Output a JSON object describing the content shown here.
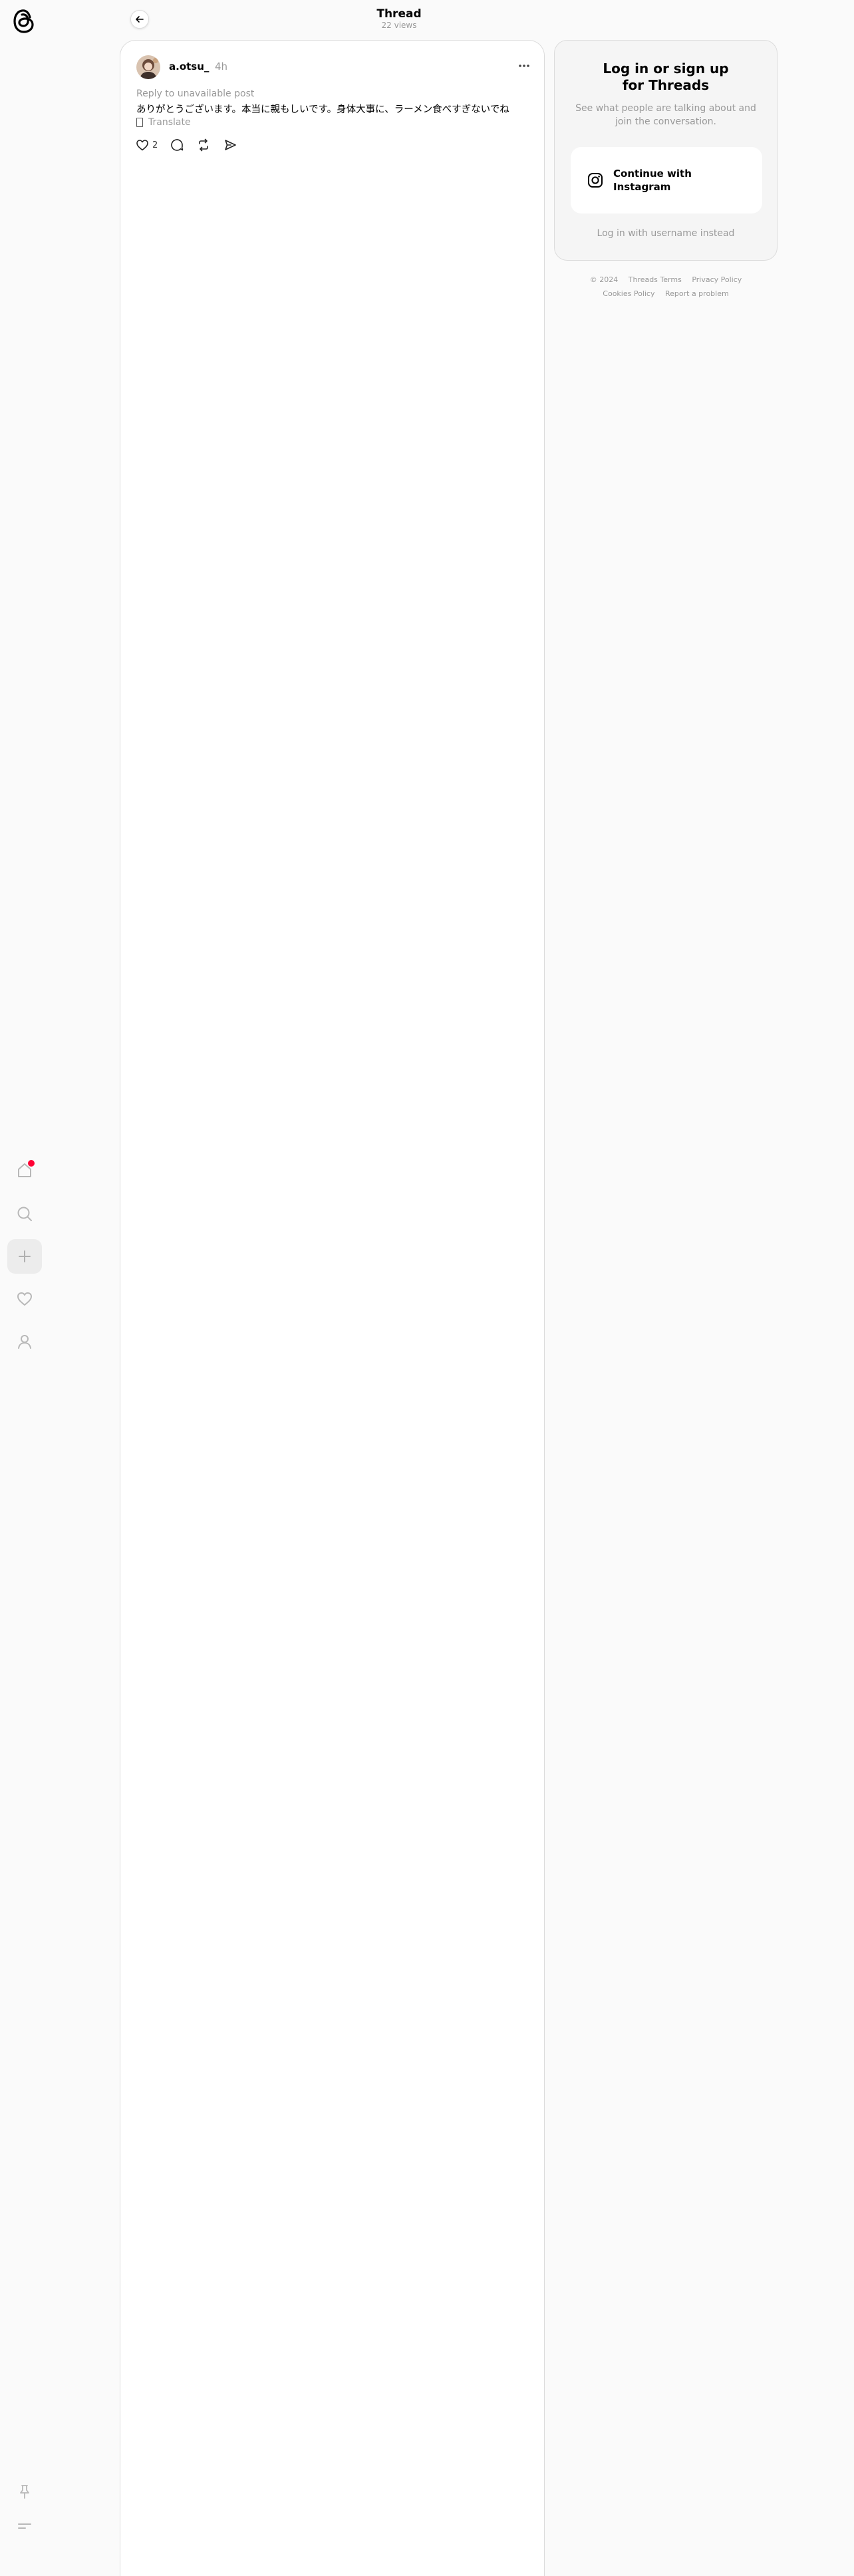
{
  "header": {
    "title": "Thread",
    "views": "22 views"
  },
  "nav": {
    "items": [
      {
        "name": "home",
        "icon": "home-icon",
        "active": false,
        "has_notification": true
      },
      {
        "name": "search",
        "icon": "search-icon",
        "active": false
      },
      {
        "name": "create",
        "icon": "plus-icon",
        "active": true
      },
      {
        "name": "activity",
        "icon": "heart-icon",
        "active": false
      },
      {
        "name": "profile",
        "icon": "person-icon",
        "active": false
      }
    ],
    "bottom": [
      {
        "name": "pin",
        "icon": "pin-icon"
      },
      {
        "name": "menu",
        "icon": "menu-icon"
      }
    ],
    "notification_color": "#ff0034"
  },
  "post": {
    "username": "a.otsu_",
    "time": "4h",
    "reply_note": "Reply to unavailable post",
    "text": "ありがとうございます。本当に親もしいです。身体大事に、ラーメン食べすぎないでね",
    "translate_label": "Translate",
    "likes": "2"
  },
  "login": {
    "title": "Log in or sign up for Threads",
    "subtitle": "See what people are talking about and join the conversation.",
    "instagram_button": "Continue with Instagram",
    "username_link": "Log in with username instead"
  },
  "footer": {
    "copyright": "© 2024",
    "terms": "Threads Terms",
    "privacy": "Privacy Policy",
    "cookies": "Cookies Policy",
    "report": "Report a problem"
  }
}
